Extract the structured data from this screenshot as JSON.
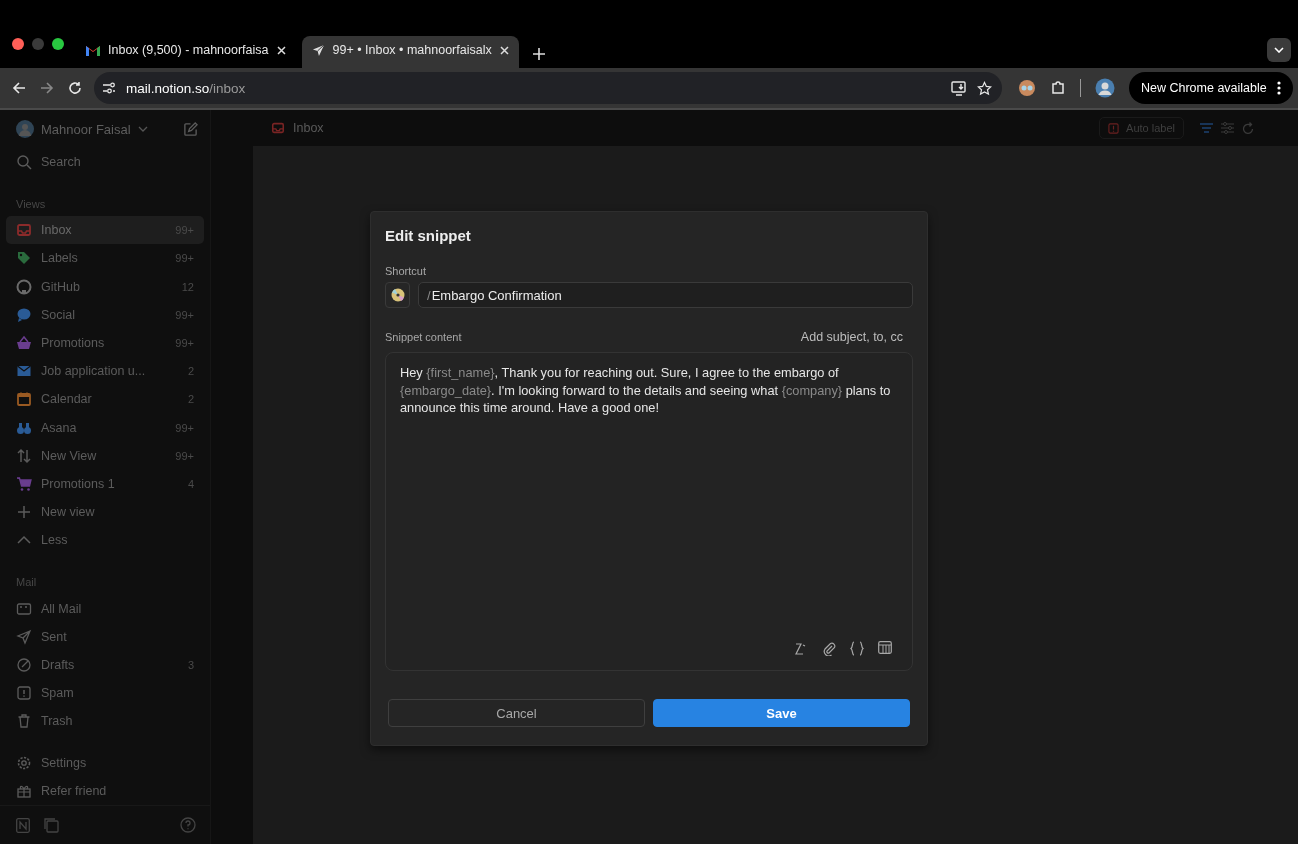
{
  "browser": {
    "tabs": [
      {
        "title": "Inbox (9,500) - mahnoorfaisa",
        "kind": "gmail",
        "selected": false
      },
      {
        "title": "99+ • Inbox • mahnoorfaisalx",
        "kind": "plane",
        "selected": true
      }
    ],
    "url": {
      "host": "mail.notion.so",
      "path": "/inbox"
    },
    "update_button": "New Chrome available"
  },
  "sidebar": {
    "account": "Mahnoor Faisal",
    "search": "Search",
    "sections": [
      {
        "title": "Views",
        "items": [
          {
            "label": "Inbox",
            "count": "99+",
            "kind": "inbox",
            "color": "#8c2b2b",
            "selected": true
          },
          {
            "label": "Labels",
            "count": "99+",
            "kind": "tag",
            "color": "#2a6b3d",
            "selected": false
          },
          {
            "label": "GitHub",
            "count": "12",
            "kind": "github",
            "color": "#6a6a6a",
            "selected": false
          },
          {
            "label": "Social",
            "count": "99+",
            "kind": "bubble",
            "color": "#2a5b96",
            "selected": false
          },
          {
            "label": "Promotions",
            "count": "99+",
            "kind": "basket",
            "color": "#6a3d8f",
            "selected": false
          },
          {
            "label": "Job application u...",
            "count": "2",
            "kind": "mail",
            "color": "#2a5b96",
            "selected": false
          },
          {
            "label": "Calendar",
            "count": "2",
            "kind": "calendar",
            "color": "#9a5a22",
            "selected": false
          },
          {
            "label": "Asana",
            "count": "99+",
            "kind": "binoculars",
            "color": "#2a5b96",
            "selected": false
          },
          {
            "label": "New View",
            "count": "99+",
            "kind": "sort",
            "color": "#5a5a5a",
            "selected": false
          },
          {
            "label": "Promotions 1",
            "count": "4",
            "kind": "cart",
            "color": "#6a3d8f",
            "selected": false
          },
          {
            "label": "New view",
            "kind": "plus"
          },
          {
            "label": "Less",
            "kind": "chevron"
          }
        ]
      },
      {
        "title": "Mail",
        "items": [
          {
            "label": "All Mail",
            "kind": "allmail"
          },
          {
            "label": "Sent",
            "kind": "send"
          },
          {
            "label": "Drafts",
            "count": "3",
            "kind": "draft"
          },
          {
            "label": "Spam",
            "kind": "spam"
          },
          {
            "label": "Trash",
            "kind": "trash"
          }
        ]
      }
    ],
    "bottom": [
      {
        "label": "Settings",
        "kind": "gear"
      },
      {
        "label": "Refer friend",
        "kind": "gift"
      }
    ]
  },
  "topbar": {
    "title": "Inbox",
    "auto_label": "Auto label"
  },
  "dialog": {
    "title": "Edit snippet",
    "shortcut_label": "Shortcut",
    "shortcut_prefix": "/",
    "shortcut_value": "Embargo Confirmation",
    "content_label": "Snippet content",
    "add_link": "Add subject, to, cc",
    "content": [
      {
        "kind": "text",
        "text": "Hey "
      },
      {
        "kind": "variable",
        "text": "{first_name}"
      },
      {
        "kind": "text",
        "text": ", Thank you for reaching out. Sure, I agree to the embargo of "
      },
      {
        "kind": "variable",
        "text": "{embargo_date}"
      },
      {
        "kind": "text",
        "text": ". I'm looking forward to the details and seeing what "
      },
      {
        "kind": "variable",
        "text": "{company}"
      },
      {
        "kind": "text",
        "text": " plans to announce this time around. Have a good one!"
      }
    ],
    "buttons": [
      {
        "label": "Cancel",
        "kind": "secondary"
      },
      {
        "label": "Save",
        "kind": "primary"
      }
    ]
  }
}
